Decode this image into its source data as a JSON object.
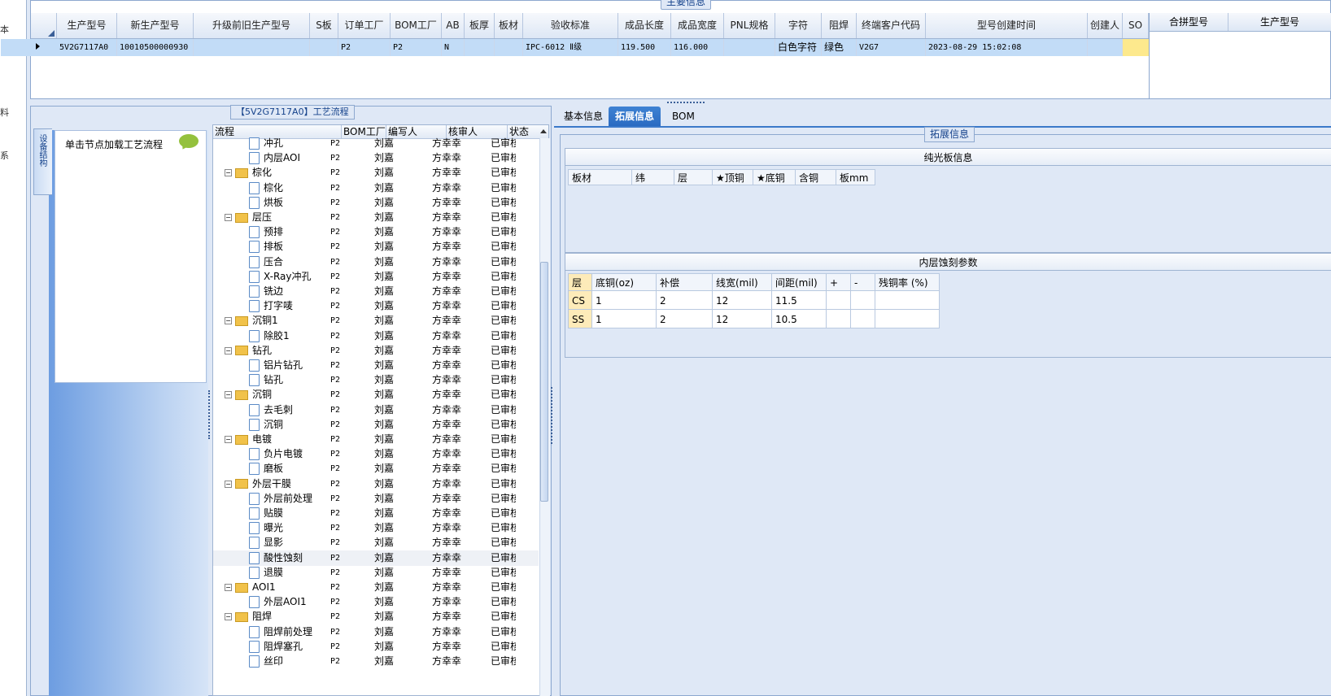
{
  "left_strip": [
    "本",
    "料",
    "系"
  ],
  "main": {
    "legend": "主要信息",
    "columns": [
      "生产型号",
      "新生产型号",
      "升级前旧生产型号",
      "S板",
      "订单工厂",
      "BOM工厂",
      "AB板",
      "板厚",
      "板材",
      "验收标准",
      "成品长度",
      "成品宽度",
      "PNL规格",
      "字符",
      "阻焊",
      "终端客户代码",
      "型号创建时间",
      "创建人",
      "SO"
    ],
    "row": [
      "5V2G7117A0",
      "10010500000930",
      "",
      "",
      "P2",
      "P2",
      "N",
      "",
      "",
      "IPC-6012 Ⅱ级",
      "119.500",
      "116.000",
      "",
      "白色字符",
      "绿色",
      "V2G7",
      "2023-08-29 15:02:08",
      "",
      ""
    ],
    "merge_columns": [
      "合拼型号",
      "生产型号"
    ]
  },
  "process": {
    "legend": "【5V2G7117A0】工艺流程",
    "vertical_tab": "设备结构",
    "hint": "单击节点加载工艺流程",
    "tree_columns": [
      "流程",
      "BOM工厂",
      "编写人",
      "核审人",
      "状态"
    ],
    "rows": [
      {
        "name": "冲孔",
        "type": "node",
        "factory": "P2",
        "author": "刘嘉",
        "checker": "方幸幸",
        "status": "已审核"
      },
      {
        "name": "内层AOI",
        "type": "node",
        "factory": "P2",
        "author": "刘嘉",
        "checker": "方幸幸",
        "status": "已审核"
      },
      {
        "name": "棕化",
        "type": "folder",
        "factory": "P2",
        "author": "刘嘉",
        "checker": "方幸幸",
        "status": "已审核"
      },
      {
        "name": "棕化",
        "type": "node",
        "factory": "P2",
        "author": "刘嘉",
        "checker": "方幸幸",
        "status": "已审核"
      },
      {
        "name": "烘板",
        "type": "node",
        "factory": "P2",
        "author": "刘嘉",
        "checker": "方幸幸",
        "status": "已审核"
      },
      {
        "name": "层压",
        "type": "folder",
        "factory": "P2",
        "author": "刘嘉",
        "checker": "方幸幸",
        "status": "已审核"
      },
      {
        "name": "预排",
        "type": "node",
        "factory": "P2",
        "author": "刘嘉",
        "checker": "方幸幸",
        "status": "已审核"
      },
      {
        "name": "排板",
        "type": "node",
        "factory": "P2",
        "author": "刘嘉",
        "checker": "方幸幸",
        "status": "已审核"
      },
      {
        "name": "压合",
        "type": "node",
        "factory": "P2",
        "author": "刘嘉",
        "checker": "方幸幸",
        "status": "已审核"
      },
      {
        "name": "X-Ray冲孔",
        "type": "node",
        "factory": "P2",
        "author": "刘嘉",
        "checker": "方幸幸",
        "status": "已审核"
      },
      {
        "name": "铣边",
        "type": "node",
        "factory": "P2",
        "author": "刘嘉",
        "checker": "方幸幸",
        "status": "已审核"
      },
      {
        "name": "打字唛",
        "type": "node",
        "factory": "P2",
        "author": "刘嘉",
        "checker": "方幸幸",
        "status": "已审核"
      },
      {
        "name": "沉铜1",
        "type": "folder",
        "factory": "P2",
        "author": "刘嘉",
        "checker": "方幸幸",
        "status": "已审核"
      },
      {
        "name": "除胶1",
        "type": "node",
        "factory": "P2",
        "author": "刘嘉",
        "checker": "方幸幸",
        "status": "已审核"
      },
      {
        "name": "钻孔",
        "type": "folder",
        "factory": "P2",
        "author": "刘嘉",
        "checker": "方幸幸",
        "status": "已审核"
      },
      {
        "name": "铝片钻孔",
        "type": "node",
        "factory": "P2",
        "author": "刘嘉",
        "checker": "方幸幸",
        "status": "已审核"
      },
      {
        "name": "钻孔",
        "type": "node",
        "factory": "P2",
        "author": "刘嘉",
        "checker": "方幸幸",
        "status": "已审核"
      },
      {
        "name": "沉铜",
        "type": "folder",
        "factory": "P2",
        "author": "刘嘉",
        "checker": "方幸幸",
        "status": "已审核"
      },
      {
        "name": "去毛刺",
        "type": "node",
        "factory": "P2",
        "author": "刘嘉",
        "checker": "方幸幸",
        "status": "已审核"
      },
      {
        "name": "沉铜",
        "type": "node",
        "factory": "P2",
        "author": "刘嘉",
        "checker": "方幸幸",
        "status": "已审核"
      },
      {
        "name": "电镀",
        "type": "folder",
        "factory": "P2",
        "author": "刘嘉",
        "checker": "方幸幸",
        "status": "已审核"
      },
      {
        "name": "负片电镀",
        "type": "node",
        "factory": "P2",
        "author": "刘嘉",
        "checker": "方幸幸",
        "status": "已审核"
      },
      {
        "name": "磨板",
        "type": "node",
        "factory": "P2",
        "author": "刘嘉",
        "checker": "方幸幸",
        "status": "已审核"
      },
      {
        "name": "外层干膜",
        "type": "folder",
        "factory": "P2",
        "author": "刘嘉",
        "checker": "方幸幸",
        "status": "已审核"
      },
      {
        "name": "外层前处理",
        "type": "node",
        "factory": "P2",
        "author": "刘嘉",
        "checker": "方幸幸",
        "status": "已审核"
      },
      {
        "name": "贴膜",
        "type": "node",
        "factory": "P2",
        "author": "刘嘉",
        "checker": "方幸幸",
        "status": "已审核"
      },
      {
        "name": "曝光",
        "type": "node",
        "factory": "P2",
        "author": "刘嘉",
        "checker": "方幸幸",
        "status": "已审核"
      },
      {
        "name": "显影",
        "type": "node",
        "factory": "P2",
        "author": "刘嘉",
        "checker": "方幸幸",
        "status": "已审核"
      },
      {
        "name": "酸性蚀刻",
        "type": "node",
        "factory": "P2",
        "author": "刘嘉",
        "checker": "方幸幸",
        "status": "已审核"
      },
      {
        "name": "退膜",
        "type": "node",
        "factory": "P2",
        "author": "刘嘉",
        "checker": "方幸幸",
        "status": "已审核"
      },
      {
        "name": "AOI1",
        "type": "folder",
        "factory": "P2",
        "author": "刘嘉",
        "checker": "方幸幸",
        "status": "已审核"
      },
      {
        "name": "外层AOI1",
        "type": "node",
        "factory": "P2",
        "author": "刘嘉",
        "checker": "方幸幸",
        "status": "已审核"
      },
      {
        "name": "阻焊",
        "type": "folder",
        "factory": "P2",
        "author": "刘嘉",
        "checker": "方幸幸",
        "status": "已审核"
      },
      {
        "name": "阻焊前处理",
        "type": "node",
        "factory": "P2",
        "author": "刘嘉",
        "checker": "方幸幸",
        "status": "已审核"
      },
      {
        "name": "阻焊塞孔",
        "type": "node",
        "factory": "P2",
        "author": "刘嘉",
        "checker": "方幸幸",
        "status": "已审核"
      },
      {
        "name": "丝印",
        "type": "node",
        "factory": "P2",
        "author": "刘嘉",
        "checker": "方幸幸",
        "status": "已审核"
      }
    ]
  },
  "detail": {
    "tabs": [
      "基本信息",
      "拓展信息",
      "BOM"
    ],
    "active_tab": "拓展信息",
    "legend": "拓展信息",
    "bare_board": {
      "title": "纯光板信息",
      "columns": [
        "板材",
        "纬",
        "层",
        "★顶铜",
        "★底铜",
        "含铜",
        "板mm"
      ]
    },
    "etch": {
      "title": "内层蚀刻参数",
      "columns": [
        "层",
        "底铜(oz)",
        "补偿",
        "线宽(mil)",
        "间距(mil)",
        "+",
        "-",
        "残铜率 (%)"
      ],
      "rows": [
        [
          "CS",
          "1",
          "2",
          "12",
          "11.5",
          "",
          "",
          ""
        ],
        [
          "SS",
          "1",
          "2",
          "12",
          "10.5",
          "",
          "",
          ""
        ]
      ]
    }
  }
}
